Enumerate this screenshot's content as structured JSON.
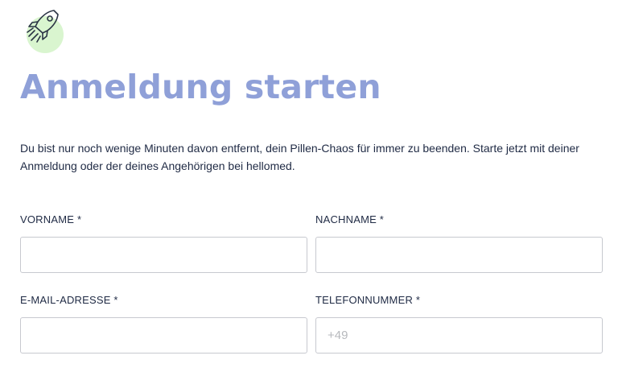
{
  "header": {
    "logo_icon": "rocket-icon",
    "title": "Anmeldung starten",
    "intro": "Du bist nur noch wenige Minuten davon entfernt, dein Pillen-Chaos für immer zu beenden. Starte jetzt mit deiner Anmeldung oder der deines Angehörigen bei hellomed."
  },
  "form": {
    "first_name": {
      "label": "VORNAME *",
      "value": "",
      "placeholder": ""
    },
    "last_name": {
      "label": "NACHNAME *",
      "value": "",
      "placeholder": ""
    },
    "email": {
      "label": "E-MAIL-ADRESSE *",
      "value": "",
      "placeholder": ""
    },
    "phone": {
      "label": "TELEFONNUMMER *",
      "value": "",
      "placeholder": "+49"
    }
  },
  "colors": {
    "title": "#8fa0d8",
    "logo_bubble": "#d9f5cf",
    "text": "#1f2a44",
    "input_border": "#c7c9cf"
  }
}
